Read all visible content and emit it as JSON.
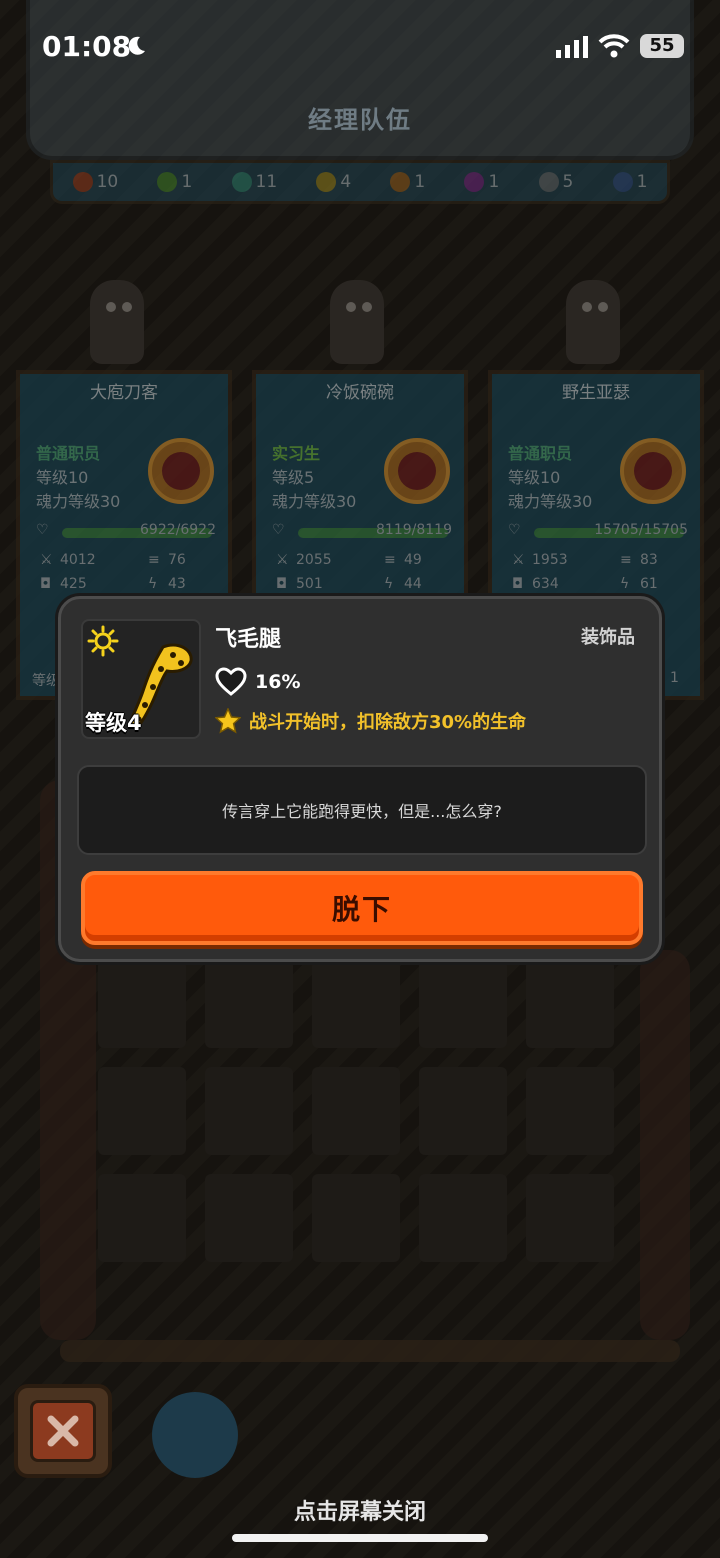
{
  "status_bar": {
    "time": "01:08",
    "battery": "55"
  },
  "header": {
    "title": "经理队伍"
  },
  "elements": [
    {
      "icon": "flame-icon",
      "count": "10",
      "color": "#e8532b"
    },
    {
      "icon": "clover-icon",
      "count": "1",
      "color": "#6ccf3a"
    },
    {
      "icon": "wave-icon",
      "count": "11",
      "color": "#35d3b6"
    },
    {
      "icon": "sun-icon",
      "count": "4",
      "color": "#f2d22a"
    },
    {
      "icon": "earth-icon",
      "count": "1",
      "color": "#e8a13a"
    },
    {
      "icon": "spiral-icon",
      "count": "1",
      "color": "#c04bd6"
    },
    {
      "icon": "tornado-icon",
      "count": "5",
      "color": "#b8c2c8"
    },
    {
      "icon": "lightning-icon",
      "count": "1",
      "color": "#3a8ae8"
    }
  ],
  "team": [
    {
      "name": "大庖刀客",
      "role": "普通职员",
      "level": "等级10",
      "soul": "魂力等级30",
      "hp": "6922/6922",
      "atk": "4012",
      "spd": "76",
      "def": "425",
      "crit": "43",
      "extra": "等级"
    },
    {
      "name": "冷饭碗碗",
      "role": "实习生",
      "level": "等级5",
      "soul": "魂力等级30",
      "hp": "8119/8119",
      "atk": "2055",
      "spd": "49",
      "def": "501",
      "crit": "44",
      "extra": ""
    },
    {
      "name": "野生亚瑟",
      "role": "普通职员",
      "level": "等级10",
      "soul": "魂力等级30",
      "hp": "15705/15705",
      "atk": "1953",
      "spd": "83",
      "def": "634",
      "crit": "61",
      "extra": "1"
    }
  ],
  "modal": {
    "item_name": "飞毛腿",
    "item_type": "装饰品",
    "item_level": "等级4",
    "heart_value": "16%",
    "skill": "战斗开始时，扣除敌方30%的生命",
    "description": "传言穿上它能跑得更快，但是...怎么穿?",
    "remove_label": "脱下"
  },
  "footer": {
    "tap_close": "点击屏幕关闭"
  }
}
